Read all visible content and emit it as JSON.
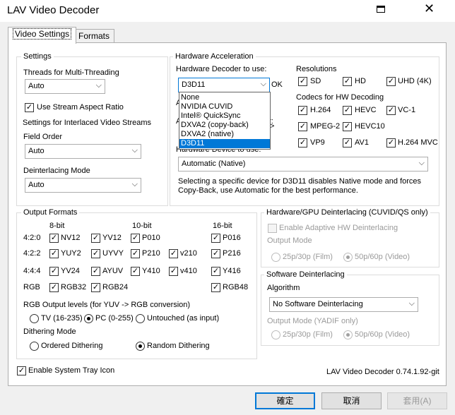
{
  "window": {
    "title": "LAV Video Decoder",
    "close_glyph": "✕",
    "icon": "window-menu-icon"
  },
  "tabs": [
    {
      "label": "Video Settings",
      "active": true
    },
    {
      "label": "Formats",
      "active": false
    }
  ],
  "settings": {
    "group_label": "Settings",
    "threads_label": "Threads for Multi-Threading",
    "threads_value": "Auto",
    "stream_aspect_label": "Use Stream Aspect Ratio",
    "stream_aspect_checked": true,
    "interlaced_label": "Settings for Interlaced Video Streams",
    "field_order_label": "Field Order",
    "field_order_value": "Auto",
    "deint_mode_label": "Deinterlacing Mode",
    "deint_mode_value": "Auto"
  },
  "hwaccel": {
    "group_label": "Hardware Acceleration",
    "decoder_label": "Hardware Decoder to use:",
    "decoder_value": "D3D11",
    "decoder_status": "OK",
    "decoder_options": [
      "None",
      "NVIDIA CUVID",
      "Intel® QuickSync",
      "DXVA2 (copy-back)",
      "DXVA2 (native)",
      "D3D11"
    ],
    "hidden_fragments": {
      "a1": "A",
      "a2": "A",
      "or": "or:",
      "arrow": ">"
    },
    "device_label": "Hardware Device to use:",
    "device_value": "Automatic (Native)",
    "note_line1": "Selecting a specific device for D3D11 disables Native mode and forces",
    "note_line2": "Copy-Back, use Automatic for the best performance.",
    "resolutions_label": "Resolutions",
    "resolutions": [
      {
        "label": "SD",
        "checked": true
      },
      {
        "label": "HD",
        "checked": true
      },
      {
        "label": "UHD (4K)",
        "checked": true
      }
    ],
    "codecs_label": "Codecs for HW Decoding",
    "codecs": [
      {
        "label": "H.264",
        "checked": true
      },
      {
        "label": "HEVC",
        "checked": true
      },
      {
        "label": "VC-1",
        "checked": true
      },
      {
        "label": "MPEG-2",
        "checked": true
      },
      {
        "label": "HEVC10",
        "checked": true
      },
      {
        "label": "VP9",
        "checked": true
      },
      {
        "label": "AV1",
        "checked": true
      },
      {
        "label": "H.264 MVC",
        "checked": true
      }
    ]
  },
  "output_formats": {
    "group_label": "Output Formats",
    "col_headers": [
      "8-bit",
      "10-bit",
      "16-bit"
    ],
    "row_labels": [
      "4:2:0",
      "4:2:2",
      "4:4:4",
      "RGB"
    ],
    "formats": [
      {
        "label": "NV12",
        "checked": true
      },
      {
        "label": "YV12",
        "checked": true
      },
      {
        "label": "P010",
        "checked": true
      },
      {
        "label": "P016",
        "checked": true
      },
      {
        "label": "YUY2",
        "checked": true
      },
      {
        "label": "UYVY",
        "checked": true
      },
      {
        "label": "P210",
        "checked": true
      },
      {
        "label": "v210",
        "checked": true
      },
      {
        "label": "P216",
        "checked": true
      },
      {
        "label": "YV24",
        "checked": true
      },
      {
        "label": "AYUV",
        "checked": true
      },
      {
        "label": "Y410",
        "checked": true
      },
      {
        "label": "v410",
        "checked": true
      },
      {
        "label": "Y416",
        "checked": true
      },
      {
        "label": "RGB32",
        "checked": true
      },
      {
        "label": "RGB24",
        "checked": true
      },
      {
        "label": "RGB48",
        "checked": true
      }
    ],
    "rgb_levels_label": "RGB Output levels (for YUV -> RGB conversion)",
    "rgb_levels": [
      {
        "label": "TV (16-235)",
        "selected": false
      },
      {
        "label": "PC (0-255)",
        "selected": true
      },
      {
        "label": "Untouched (as input)",
        "selected": false
      }
    ],
    "dither_label": "Dithering Mode",
    "dither": [
      {
        "label": "Ordered Dithering",
        "selected": false
      },
      {
        "label": "Random Dithering",
        "selected": true
      }
    ]
  },
  "hw_deint": {
    "group_label": "Hardware/GPU Deinterlacing (CUVID/QS only)",
    "adaptive_label": "Enable Adaptive HW Deinterlacing",
    "output_mode_label": "Output Mode",
    "modes": [
      {
        "label": "25p/30p (Film)",
        "selected": false
      },
      {
        "label": "50p/60p (Video)",
        "selected": true
      }
    ]
  },
  "sw_deint": {
    "group_label": "Software Deinterlacing",
    "algorithm_label": "Algorithm",
    "algorithm_value": "No Software Deinterlacing",
    "output_mode_label": "Output Mode (YADIF only)",
    "modes": [
      {
        "label": "25p/30p (Film)",
        "selected": false
      },
      {
        "label": "50p/60p (Video)",
        "selected": true
      }
    ]
  },
  "tray_label": "Enable System Tray Icon",
  "tray_checked": true,
  "version": "LAV Video Decoder 0.74.1.92-git",
  "buttons": {
    "ok": "確定",
    "cancel": "取消",
    "apply": "套用(A)"
  },
  "glyphs": {
    "check": "✓",
    "combo_arrow": "⌵"
  }
}
